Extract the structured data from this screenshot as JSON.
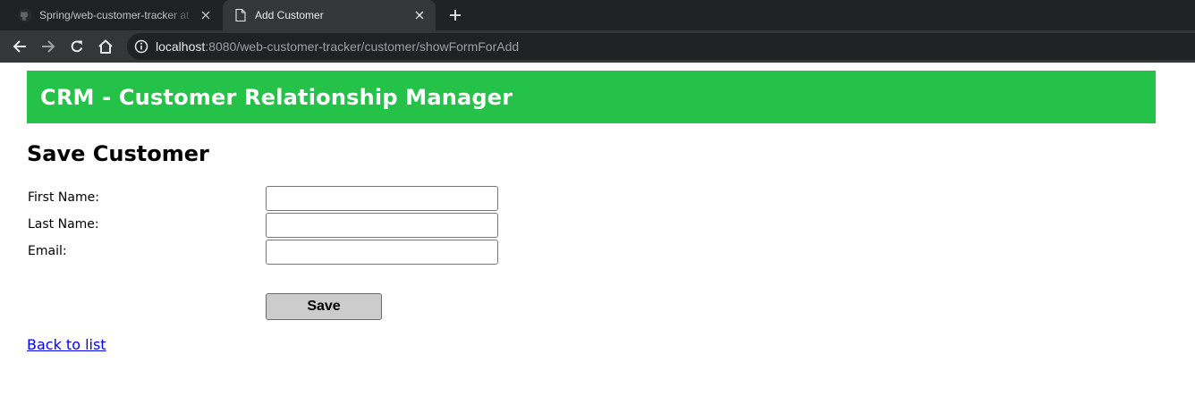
{
  "browser": {
    "tabs": [
      {
        "title": "Spring/web-customer-tracker at",
        "favicon": "github-icon",
        "active": false
      },
      {
        "title": "Add Customer",
        "favicon": "page-icon",
        "active": true
      }
    ],
    "new_tab_icon": "plus-icon",
    "close_icon": "close-icon",
    "nav": {
      "back": "back-arrow-icon",
      "forward": "forward-arrow-icon",
      "reload": "reload-icon",
      "home": "home-icon"
    },
    "url_host": "localhost",
    "url_rest": ":8080/web-customer-tracker/customer/showFormForAdd",
    "colors": {
      "tabstrip": "#202124",
      "toolbar": "#35363a",
      "omnibox": "#202124"
    }
  },
  "header": {
    "title": "CRM - Customer Relationship Manager",
    "color": "#24c248"
  },
  "form": {
    "heading": "Save Customer",
    "fields": [
      {
        "label": "First Name:",
        "value": ""
      },
      {
        "label": "Last Name:",
        "value": ""
      },
      {
        "label": "Email:",
        "value": ""
      }
    ],
    "save_label": "Save"
  },
  "back_link": "Back to list"
}
